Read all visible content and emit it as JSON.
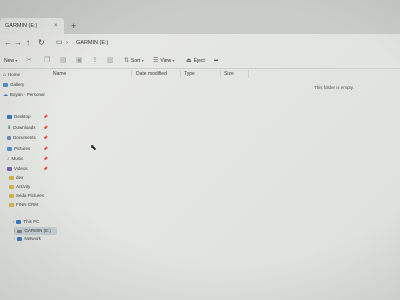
{
  "tab": {
    "title": "GARMIN (E:)",
    "close": "×",
    "add": "+"
  },
  "nav": {
    "back": "←",
    "forward": "→",
    "up": "↑",
    "refresh": "↻",
    "crumb_sep": "›",
    "location": "GARMIN (E:)"
  },
  "commands": {
    "new": "New",
    "sort": "Sort",
    "view": "View",
    "eject": "Eject",
    "more": "•••"
  },
  "columns": {
    "name": "Name",
    "date": "Date modified",
    "type": "Type",
    "size": "Size"
  },
  "empty_message": "This folder is empty.",
  "sidebar": {
    "home": "Home",
    "gallery": "Gallery",
    "onedrive": "Boyan - Personal",
    "desktop": "Desktop",
    "downloads": "Downloads",
    "documents": "Documents",
    "pictures": "Pictures",
    "music": "Music",
    "videos": "Videos",
    "f1": "dev",
    "f2": "Activity",
    "f3": "Seda Pictures",
    "f4": "FINN CRM",
    "thispc": "This PC",
    "garmin": "GARMIN (E:)",
    "network": "Network"
  },
  "colors": {
    "selection": "#c7d0d6",
    "folder": "#d9b54a",
    "accent": "#3b78c4"
  }
}
